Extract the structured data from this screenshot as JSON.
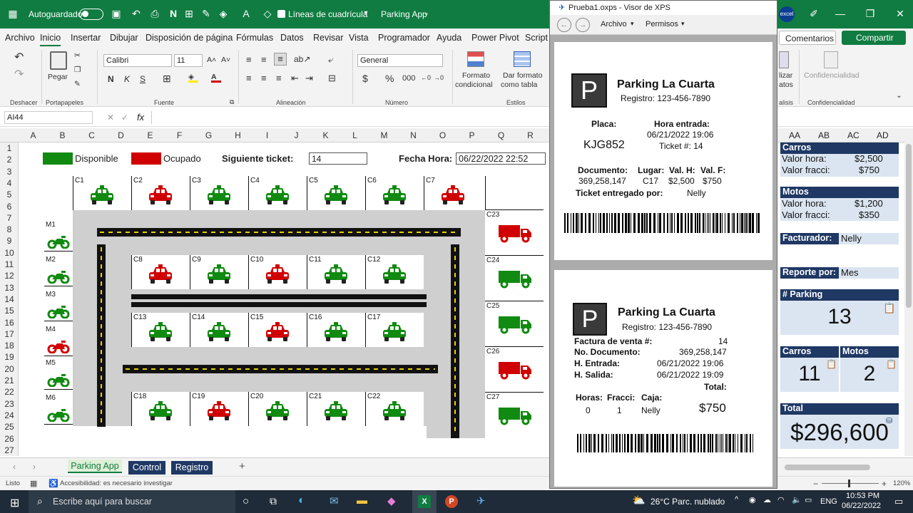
{
  "titlebar": {
    "autosave_label": "Autoguardado",
    "gridlines_label": "Líneas de cuadrícula",
    "doc_title": "Parking App",
    "colors": {
      "bg": "#107c41"
    }
  },
  "menubar": {
    "items": [
      "Archivo",
      "Inicio",
      "Insertar",
      "Dibujar",
      "Disposición de página",
      "Fórmulas",
      "Datos",
      "Revisar",
      "Vista",
      "Programador",
      "Ayuda",
      "Power Pivot",
      "Script"
    ],
    "comments": "Comentarios",
    "share": "Compartir"
  },
  "ribbon": {
    "undo_group": "Deshacer",
    "clipboard_group": "Portapapeles",
    "paste_label": "Pegar",
    "font_group": "Fuente",
    "font_name": "Calibri",
    "font_size": "11",
    "bold": "N",
    "italic": "K",
    "underline": "S",
    "align_group": "Alineación",
    "number_group": "Número",
    "number_format": "General",
    "cond_format_1": "Formato",
    "cond_format_2": "condicional",
    "table_format_1": "Dar formato",
    "table_format_2": "como tabla",
    "styles_group": "Estilos",
    "analyze_1": "lizar",
    "analyze_2": "atos",
    "analyze_group": "alisis",
    "sensitivity_label": "Confidencialidad",
    "sensitivity_group": "Confidencialidad"
  },
  "formula_bar": {
    "name_box": "AI44",
    "fx": "fx",
    "value": ""
  },
  "columns": [
    "A",
    "B",
    "C",
    "D",
    "E",
    "F",
    "G",
    "H",
    "I",
    "J",
    "K",
    "L",
    "M",
    "N",
    "O",
    "P",
    "Q",
    "R"
  ],
  "right_columns": [
    "AA",
    "AB",
    "AC",
    "AD"
  ],
  "rows": [
    "1",
    "2",
    "3",
    "4",
    "5",
    "6",
    "7",
    "8",
    "9",
    "10",
    "11",
    "12",
    "13",
    "14",
    "15",
    "16",
    "17",
    "18",
    "19",
    "20",
    "21",
    "22",
    "23",
    "24",
    "25",
    "26",
    "27"
  ],
  "sheet": {
    "available_label": "Disponible",
    "occupied_label": "Ocupado",
    "next_ticket_label": "Siguiente ticket:",
    "next_ticket_value": "14",
    "datetime_label": "Fecha Hora:",
    "datetime_value": "06/22/2022 22:52",
    "colors": {
      "available": "#108a10",
      "occupied": "#d00000"
    },
    "car_spots": [
      {
        "id": "C1",
        "status": "available"
      },
      {
        "id": "C2",
        "status": "occupied"
      },
      {
        "id": "C3",
        "status": "available"
      },
      {
        "id": "C4",
        "status": "available"
      },
      {
        "id": "C5",
        "status": "available"
      },
      {
        "id": "C6",
        "status": "available"
      },
      {
        "id": "C7",
        "status": "occupied"
      },
      {
        "id": "C8",
        "status": "occupied"
      },
      {
        "id": "C9",
        "status": "available"
      },
      {
        "id": "C10",
        "status": "occupied"
      },
      {
        "id": "C11",
        "status": "available"
      },
      {
        "id": "C12",
        "status": "available"
      },
      {
        "id": "C13",
        "status": "available"
      },
      {
        "id": "C14",
        "status": "available"
      },
      {
        "id": "C15",
        "status": "occupied"
      },
      {
        "id": "C16",
        "status": "available"
      },
      {
        "id": "C17",
        "status": "available"
      },
      {
        "id": "C18",
        "status": "available"
      },
      {
        "id": "C19",
        "status": "occupied"
      },
      {
        "id": "C20",
        "status": "available"
      },
      {
        "id": "C21",
        "status": "available"
      },
      {
        "id": "C22",
        "status": "available"
      }
    ],
    "moto_spots": [
      {
        "id": "M1",
        "status": "available"
      },
      {
        "id": "M2",
        "status": "available"
      },
      {
        "id": "M3",
        "status": "available"
      },
      {
        "id": "M4",
        "status": "occupied"
      },
      {
        "id": "M5",
        "status": "available"
      },
      {
        "id": "M6",
        "status": "available"
      }
    ],
    "truck_spots": [
      {
        "id": "C23",
        "status": "occupied"
      },
      {
        "id": "C24",
        "status": "available"
      },
      {
        "id": "C25",
        "status": "available"
      },
      {
        "id": "C26",
        "status": "occupied"
      },
      {
        "id": "C27",
        "status": "available"
      }
    ]
  },
  "tabs": {
    "items": [
      "Parking App",
      "Control",
      "Registro"
    ],
    "add": "+"
  },
  "statusbar": {
    "ready": "Listo",
    "accessibility": "Accesibilidad: es necesario investigar",
    "zoom": "120%"
  },
  "xps": {
    "title": "Prueba1.oxps - Visor de XPS",
    "menu_file": "Archivo",
    "menu_perms": "Permisos",
    "logo_letter": "P",
    "entry": {
      "business": "Parking La Cuarta",
      "registry": "Registro: 123-456-7890",
      "plate_label": "Placa:",
      "plate": "KJG852",
      "entry_label": "Hora entrada:",
      "entry_time": "06/21/2022 19:06",
      "ticket": "Ticket #: 14",
      "doc_label": "Documento:",
      "doc": "369,258,147",
      "place_label": "Lugar:",
      "place": "C17",
      "valh_label": "Val. H:",
      "valh": "$2,500",
      "valf_label": "Val. F:",
      "valf": "$750",
      "delivered_label": "Ticket entregado por:",
      "delivered": "Nelly"
    },
    "invoice": {
      "business": "Parking La Cuarta",
      "registry": "Registro: 123-456-7890",
      "invoice_label": "Factura de venta #:",
      "invoice": "14",
      "doc_label": "No. Documento:",
      "doc": "369,258,147",
      "in_label": "H. Entrada:",
      "in": "06/21/2022 19:06",
      "out_label": "H. Salida:",
      "out": "06/21/2022 19:09",
      "total_label": "Total:",
      "hours_label": "Horas:",
      "hours": "0",
      "frac_label": "Fracci:",
      "frac": "1",
      "cashier_label": "Caja:",
      "cashier": "Nelly",
      "total": "$750"
    }
  },
  "panel": {
    "cars_title": "Carros",
    "cars_hour_label": "Valor hora:",
    "cars_hour": "$2,500",
    "cars_frac_label": "Valor fracci:",
    "cars_frac": "$750",
    "motos_title": "Motos",
    "motos_hour_label": "Valor hora:",
    "motos_hour": "$1,200",
    "motos_frac_label": "Valor fracci:",
    "motos_frac": "$350",
    "biller_label": "Facturador:",
    "biller": "Nelly",
    "report_label": "Reporte por:",
    "report": "Mes",
    "parking_title": "# Parking",
    "parking_count": "13",
    "cars_count_title": "Carros",
    "motos_count_title": "Motos",
    "cars_count": "11",
    "motos_count": "2",
    "total_title": "Total",
    "total": "$296,600",
    "colors": {
      "header": "#1f3864",
      "box": "#dbe5f1"
    }
  },
  "taskbar": {
    "search": "Escribe aquí para buscar",
    "weather": "26°C  Parc. nublado",
    "lang": "ENG",
    "time": "10:53 PM",
    "date": "06/22/2022"
  }
}
